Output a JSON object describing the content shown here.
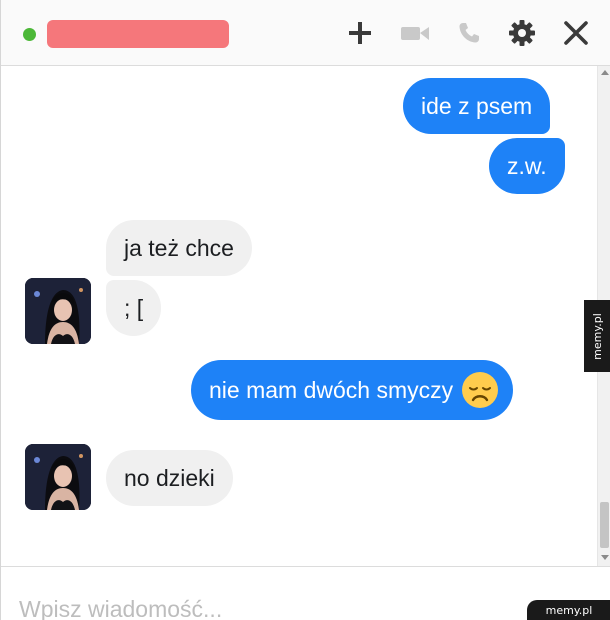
{
  "header": {
    "status_color": "#4cb838",
    "redacted_name_color": "#f5777b",
    "icons": [
      "plus-icon",
      "video-camera-icon",
      "phone-icon",
      "gear-icon",
      "close-icon"
    ]
  },
  "messages": [
    {
      "direction": "outgoing",
      "text": "ide z psem"
    },
    {
      "direction": "outgoing",
      "text": "z.w."
    },
    {
      "direction": "incoming",
      "text": "ja też chce"
    },
    {
      "direction": "incoming",
      "text": "; ["
    },
    {
      "direction": "outgoing",
      "text": "nie mam dwóch smyczy",
      "emoji": "disappointed-face-icon"
    },
    {
      "direction": "incoming",
      "text": "no dzieki"
    }
  ],
  "colors": {
    "outgoing_bubble": "#1e82f7",
    "incoming_bubble": "#f0f0f0"
  },
  "composer": {
    "placeholder": "Wpisz wiadomość..."
  },
  "watermark": {
    "side": "memy.pl",
    "corner": "memy.pl"
  }
}
